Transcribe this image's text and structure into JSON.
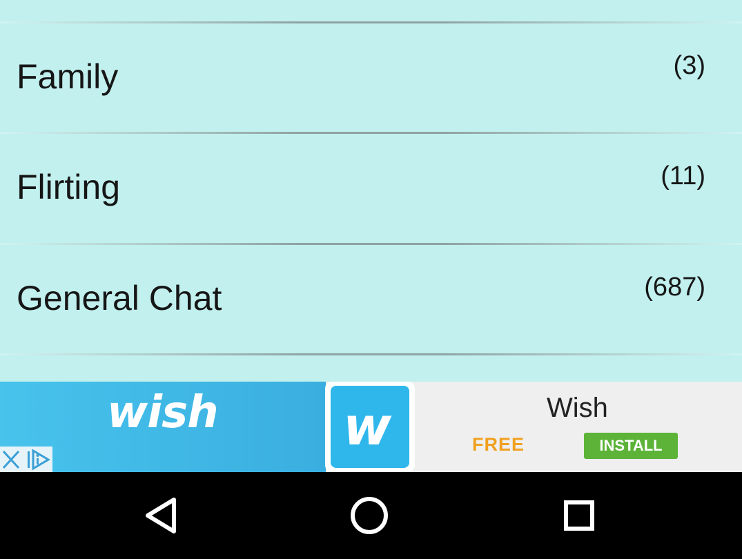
{
  "categories": [
    {
      "label": "Family",
      "count": "(3)"
    },
    {
      "label": "Flirting",
      "count": "(11)"
    },
    {
      "label": "General Chat",
      "count": "(687)"
    }
  ],
  "ad": {
    "wordmark": "wish",
    "logo_letter": "w",
    "app_name": "Wish",
    "price": "FREE",
    "install_label": "INSTALL",
    "colors": {
      "brand": "#2fb7ec",
      "install": "#5cb338",
      "free": "#f0a020"
    }
  },
  "navbar": {
    "back_icon": "back-triangle-icon",
    "home_icon": "home-circle-icon",
    "recents_icon": "recents-square-icon"
  },
  "colors": {
    "list_background": "#c1f0ee",
    "text": "#161616"
  }
}
